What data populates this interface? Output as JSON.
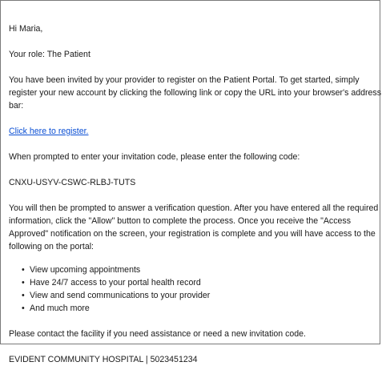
{
  "email": {
    "greeting": "Hi Maria,",
    "role_line": "Your role: The Patient",
    "invite_paragraph": "You have been invited by your provider to register on the Patient Portal. To get started, simply register your new account by clicking the following link or copy the URL into your browser's address bar:",
    "register_link": "Click here to register.",
    "code_prompt": "When prompted to enter your invitation code, please enter the following code:",
    "invitation_code": "CNXU-USYV-CSWC-RLBJ-TUTS",
    "verification_paragraph": "You will then be prompted to answer a verification question. After you have entered all the required information, click the \"Allow\" button to complete the process. Once you receive the \"Access Approved\" notification on the screen, your registration is complete and you will have access to the following on the portal:",
    "features": [
      "View upcoming appointments",
      "Have 24/7 access to your portal health record",
      "View and send communications to your provider",
      "And much more"
    ],
    "contact_line": "Please contact the facility if you need assistance or need a new invitation code.",
    "footer": "EVIDENT COMMUNITY HOSPITAL | 5023451234"
  },
  "icons": {
    "bullet": "•"
  },
  "colors": {
    "link": "#0b4fd4",
    "border": "#7a7a7a",
    "text": "#1a1a1a"
  }
}
